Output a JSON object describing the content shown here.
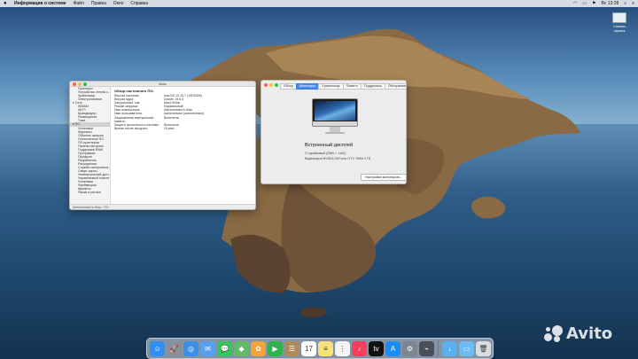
{
  "menubar": {
    "app_name": "Информация о системе",
    "items": [
      "Файл",
      "Правка",
      "Окно",
      "Справка"
    ],
    "clock": "Вс 13:28"
  },
  "desktop_icon": {
    "label": "Снимок экрана"
  },
  "info_window": {
    "title": "iMac",
    "sidebar": [
      {
        "label": "Принтеры",
        "grp": false
      },
      {
        "label": "Устройство чтения к...",
        "grp": false
      },
      {
        "label": "Хранилище",
        "grp": false
      },
      {
        "label": "Электропитание",
        "grp": false
      },
      {
        "label": "▾ Сеть",
        "grp": true
      },
      {
        "label": "WWAN",
        "grp": false
      },
      {
        "label": "Wi-Fi",
        "grp": false
      },
      {
        "label": "Брандмауэр",
        "grp": false
      },
      {
        "label": "Размещения",
        "grp": false
      },
      {
        "label": "Тома",
        "grp": false
      },
      {
        "label": "▾ ПО",
        "grp": true,
        "selected": true
      },
      {
        "label": "Установки",
        "grp": false
      },
      {
        "label": "Журналы",
        "grp": false
      },
      {
        "label": "Объекты запуска",
        "grp": false
      },
      {
        "label": "Отключенное ПО",
        "grp": false
      },
      {
        "label": "ПО принтеров",
        "grp": false
      },
      {
        "label": "Панели настроек",
        "grp": false
      },
      {
        "label": "Поддержка RAW",
        "grp": false
      },
      {
        "label": "Программы",
        "grp": false
      },
      {
        "label": "Профили",
        "grp": false
      },
      {
        "label": "Разработчик",
        "grp": false
      },
      {
        "label": "Расширения",
        "grp": false
      },
      {
        "label": "Службы синхрониза...",
        "grp": false
      },
      {
        "label": "Смарт-карты",
        "grp": false
      },
      {
        "label": "Универсальный дост...",
        "grp": false
      },
      {
        "label": "Управляемый клиент",
        "grp": false
      },
      {
        "label": "Установки",
        "grp": false
      },
      {
        "label": "Фреймворки",
        "grp": false
      },
      {
        "label": "Шрифты",
        "grp": false
      },
      {
        "label": "Языки и регион",
        "grp": false
      }
    ],
    "heading": "Обзор системного ПО:",
    "details": [
      {
        "k": "Версия системы:",
        "v": "macOS 10.15.7 (19H2026)"
      },
      {
        "k": "Версия ядра:",
        "v": "Darwin 19.6.0"
      },
      {
        "k": "Загрузочный том:",
        "v": "MacOSofia"
      },
      {
        "k": "Режим загрузки:",
        "v": "Нормальный"
      },
      {
        "k": "Имя компьютера:",
        "v": "Administrator's iMac"
      },
      {
        "k": "Имя пользователя:",
        "v": "Administrator (administrator)"
      },
      {
        "k": "Защищенная виртуальная память:",
        "v": "Включена"
      },
      {
        "k": "Защита целостности системы:",
        "v": "Включена"
      },
      {
        "k": "Время после загрузки:",
        "v": "15 мин"
      }
    ],
    "status": "Administrator's iMac › ПО"
  },
  "about_window": {
    "tabs": [
      "Обзор",
      "Мониторы",
      "Хранилище",
      "Память",
      "Поддержка",
      "Обслуживание"
    ],
    "active_tab": 1,
    "display_name": "Встроенный дисплей",
    "resolution": "27-дюймовый (2560 × 1440)",
    "gpu": "Видеокарта NVIDIA GeForce GTX 780M 4 ГБ",
    "button": "Настройки мониторов..."
  },
  "dock": {
    "icons": [
      {
        "name": "finder-icon",
        "color": "#2f8ff3",
        "glyph": "☺"
      },
      {
        "name": "launchpad-icon",
        "color": "#8a8f98",
        "glyph": "🚀"
      },
      {
        "name": "safari-icon",
        "color": "#3a8fe8",
        "glyph": "◎"
      },
      {
        "name": "mail-icon",
        "color": "#5aa0f0",
        "glyph": "✉"
      },
      {
        "name": "messages-icon",
        "color": "#34c759",
        "glyph": "💬"
      },
      {
        "name": "maps-icon",
        "color": "#64b968",
        "glyph": "◆"
      },
      {
        "name": "photos-icon",
        "color": "#f2a33a",
        "glyph": "✿"
      },
      {
        "name": "facetime-icon",
        "color": "#2fb14c",
        "glyph": "▶"
      },
      {
        "name": "contacts-icon",
        "color": "#b08b5a",
        "glyph": "☰"
      },
      {
        "name": "calendar-icon",
        "color": "#ffffff",
        "glyph": "17"
      },
      {
        "name": "notes-icon",
        "color": "#f6e27a",
        "glyph": "≡"
      },
      {
        "name": "reminders-icon",
        "color": "#f4f4f4",
        "glyph": "⋮"
      },
      {
        "name": "music-icon",
        "color": "#fa3d5c",
        "glyph": "♪"
      },
      {
        "name": "tv-icon",
        "color": "#111111",
        "glyph": "tv"
      },
      {
        "name": "appstore-icon",
        "color": "#1a8cf5",
        "glyph": "A"
      },
      {
        "name": "system-preferences-icon",
        "color": "#7d8590",
        "glyph": "⚙"
      },
      {
        "name": "system-information-icon",
        "color": "#4a4f57",
        "glyph": "⌁"
      }
    ],
    "right_icons": [
      {
        "name": "downloads-folder-icon",
        "color": "#5ab0ef",
        "glyph": "↓"
      },
      {
        "name": "documents-folder-icon",
        "color": "#6dbbf2",
        "glyph": "▭"
      },
      {
        "name": "trash-icon",
        "color": "#d9dde2",
        "glyph": "🗑"
      }
    ]
  },
  "watermark": {
    "text": "Avito"
  }
}
